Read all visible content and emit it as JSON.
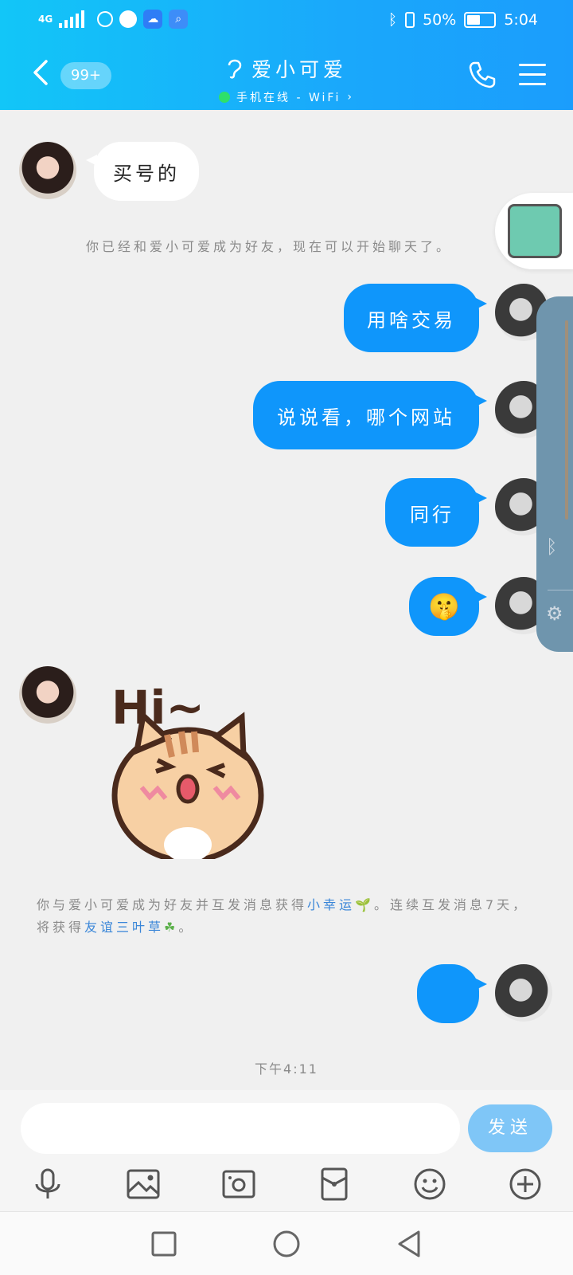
{
  "status_bar": {
    "network": "4G",
    "battery_percent": "50%",
    "time": "5:04"
  },
  "header": {
    "back_icon": "chevron-left-icon",
    "unread_badge": "99+",
    "contact_name": "爱小可爱",
    "status_text": "手机在线 - WiFi",
    "status_color": "#2ee06a",
    "call_icon": "phone-icon",
    "menu_icon": "menu-icon",
    "accent": "#1aa8fb"
  },
  "messages": [
    {
      "sender": "contact",
      "text": "买号的"
    },
    {
      "sender": "me",
      "text": "用啥交易"
    },
    {
      "sender": "me",
      "text": "说说看，哪个网站"
    },
    {
      "sender": "me",
      "text": "同行"
    },
    {
      "sender": "me",
      "text": "🤫"
    },
    {
      "sender": "contact",
      "sticker": "Hi~"
    },
    {
      "sender": "me",
      "text": ""
    }
  ],
  "system_messages": {
    "friend_added": "你已经和爱小可爱成为好友，现在可以开始聊天了。",
    "reward_prefix": "你与爱小可爱成为好友并互发消息获得",
    "reward_link1": "小幸运",
    "reward_mid": "。连续互发消息7天，将获得",
    "reward_link2": "友谊三叶草",
    "reward_suffix": "。"
  },
  "timestamp": "下午4:11",
  "composer": {
    "placeholder": "",
    "send_label": "发送"
  },
  "toolbar_icons": [
    "microphone-icon",
    "image-icon",
    "camera-icon",
    "red-packet-icon",
    "emoji-icon",
    "plus-icon"
  ]
}
